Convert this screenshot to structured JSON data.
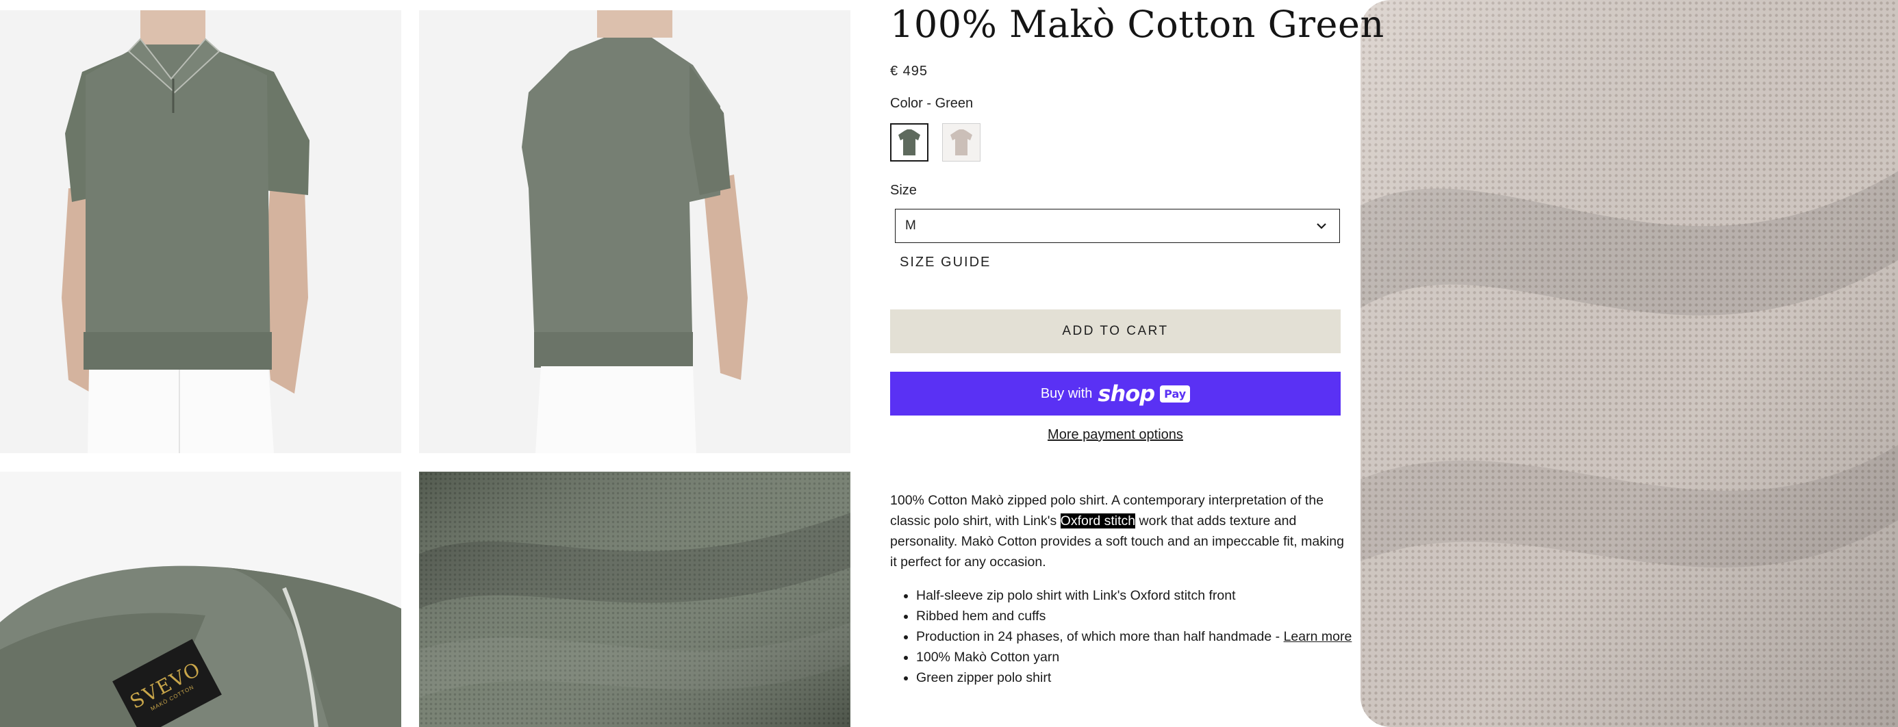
{
  "product": {
    "title": "100% Makò Cotton Green",
    "price": "€ 495",
    "color_label": "Color - Green",
    "swatches": [
      {
        "name": "Green",
        "color": "#5e6a5d"
      },
      {
        "name": "Sand",
        "color": "#cbbfb8"
      }
    ],
    "size_label": "Size",
    "size_value": "M",
    "size_guide": "SIZE GUIDE",
    "add_to_cart": "ADD TO CART",
    "buy_with": "Buy with",
    "shop_logo": "shop",
    "pay_badge": "Pay",
    "more_payment_options": "More payment options"
  },
  "description": {
    "part1": "100% Cotton Makò zipped polo shirt. A contemporary interpretation of the classic polo shirt, with Link's ",
    "highlight": "Oxford stitch",
    "part2": " work that adds texture and personality. Makò Cotton provides a soft touch and an impeccable fit, making it perfect for any occasion."
  },
  "features": {
    "items": [
      "Half-sleeve zip polo shirt with Link's Oxford stitch front",
      "Ribbed hem and cuffs",
      "Production in 24 phases, of which more than half handmade - ",
      "100% Makò Cotton yarn",
      "Green zipper polo shirt"
    ],
    "learn_more": "Learn more"
  },
  "images": {
    "label_brand": "SVEVO",
    "label_sub": "MAKÒ COTTON"
  },
  "colors": {
    "shirt_green": "#707a6d",
    "knit_sand": "#d8cfc9",
    "shop_pay_purple": "#5a31f4",
    "add_to_cart_bg": "#e3e0d5"
  }
}
